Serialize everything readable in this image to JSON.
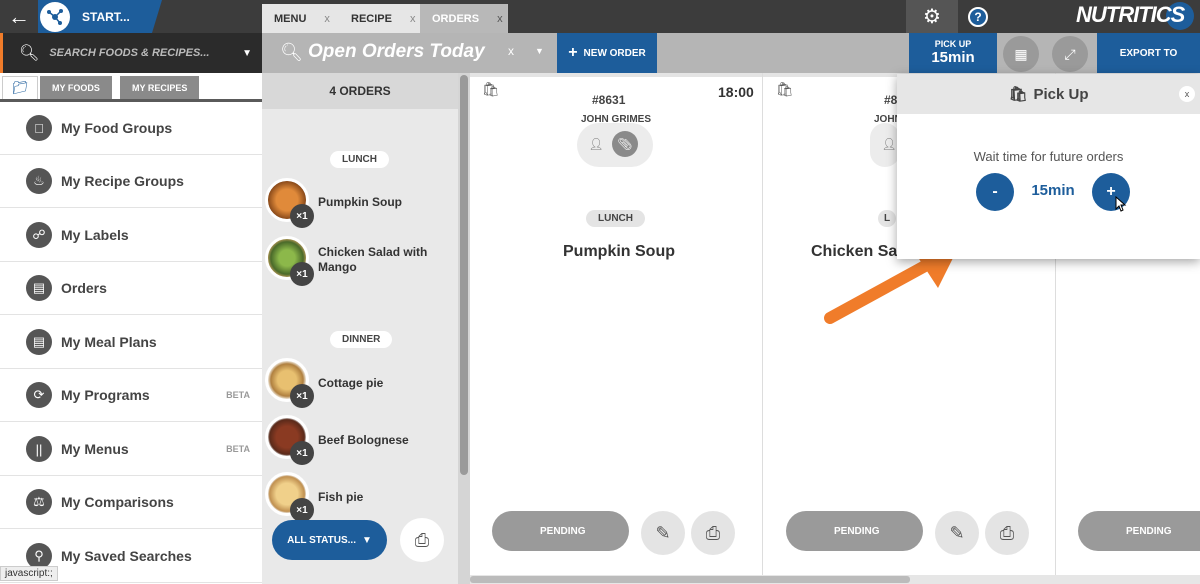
{
  "topbar": {
    "start_label": "START...",
    "tabs": [
      {
        "label": "MENU",
        "close": "x"
      },
      {
        "label": "RECIPE",
        "close": "x"
      },
      {
        "label": "ORDERS",
        "close": "x"
      }
    ],
    "help": "?",
    "brand": "NUTRITICS"
  },
  "search": {
    "placeholder": "SEARCH FOODS & RECIPES..."
  },
  "toolbar": {
    "title": "Open Orders Today",
    "clear": "x",
    "new_order": "NEW ORDER",
    "pickup_label": "PICK UP",
    "pickup_value": "15min",
    "export": "EXPORT TO"
  },
  "sidebar": {
    "tabs": [
      "MY FOODS",
      "MY RECIPES"
    ],
    "items": [
      {
        "label": "My Food Groups",
        "icon": "apple-icon",
        "beta": ""
      },
      {
        "label": "My Recipe Groups",
        "icon": "chef-hat-icon",
        "beta": ""
      },
      {
        "label": "My Labels",
        "icon": "tag-icon",
        "beta": ""
      },
      {
        "label": "Orders",
        "icon": "document-icon",
        "beta": ""
      },
      {
        "label": "My Meal Plans",
        "icon": "document-icon",
        "beta": ""
      },
      {
        "label": "My Programs",
        "icon": "programs-icon",
        "beta": "BETA"
      },
      {
        "label": "My Menus",
        "icon": "cutlery-icon",
        "beta": "BETA"
      },
      {
        "label": "My Comparisons",
        "icon": "scales-icon",
        "beta": ""
      },
      {
        "label": "My Saved Searches",
        "icon": "search-icon",
        "beta": ""
      }
    ],
    "status_text": "javascript:;"
  },
  "orders": {
    "count": "4 ORDERS",
    "groups": [
      {
        "label": "LUNCH"
      },
      {
        "label": "DINNER"
      }
    ],
    "items": [
      {
        "name": "Pumpkin Soup",
        "qty": "×1",
        "color": "#c9752a"
      },
      {
        "name": "Chicken Salad with Mango",
        "qty": "×1",
        "color": "#5f8a3a"
      },
      {
        "name": "Cottage pie",
        "qty": "×1",
        "color": "#c9a15a"
      },
      {
        "name": "Beef Bolognese",
        "qty": "×1",
        "color": "#7a3a22"
      },
      {
        "name": "Fish pie",
        "qty": "×1",
        "color": "#d9b56a"
      }
    ],
    "filter": "ALL STATUS..."
  },
  "cards": [
    {
      "number": "#8631",
      "time": "18:00",
      "customer": "JOHN GRIMES",
      "meal": "LUNCH",
      "dish": "Pumpkin Soup",
      "status": "PENDING"
    },
    {
      "number": "#8",
      "time": "",
      "customer": "JOHN",
      "meal": "L",
      "dish": "Chicken Sal",
      "status": "PENDING"
    },
    {
      "number": "",
      "time": "",
      "customer": "",
      "meal": "",
      "dish": "",
      "status": "PENDING"
    }
  ],
  "popup": {
    "title": "Pick Up",
    "close": "x",
    "wait_label": "Wait time for future orders",
    "minus": "-",
    "value": "15min",
    "plus": "+"
  },
  "colors": {
    "brand_blue": "#1d5d9b",
    "accent_orange": "#f07c2a"
  }
}
